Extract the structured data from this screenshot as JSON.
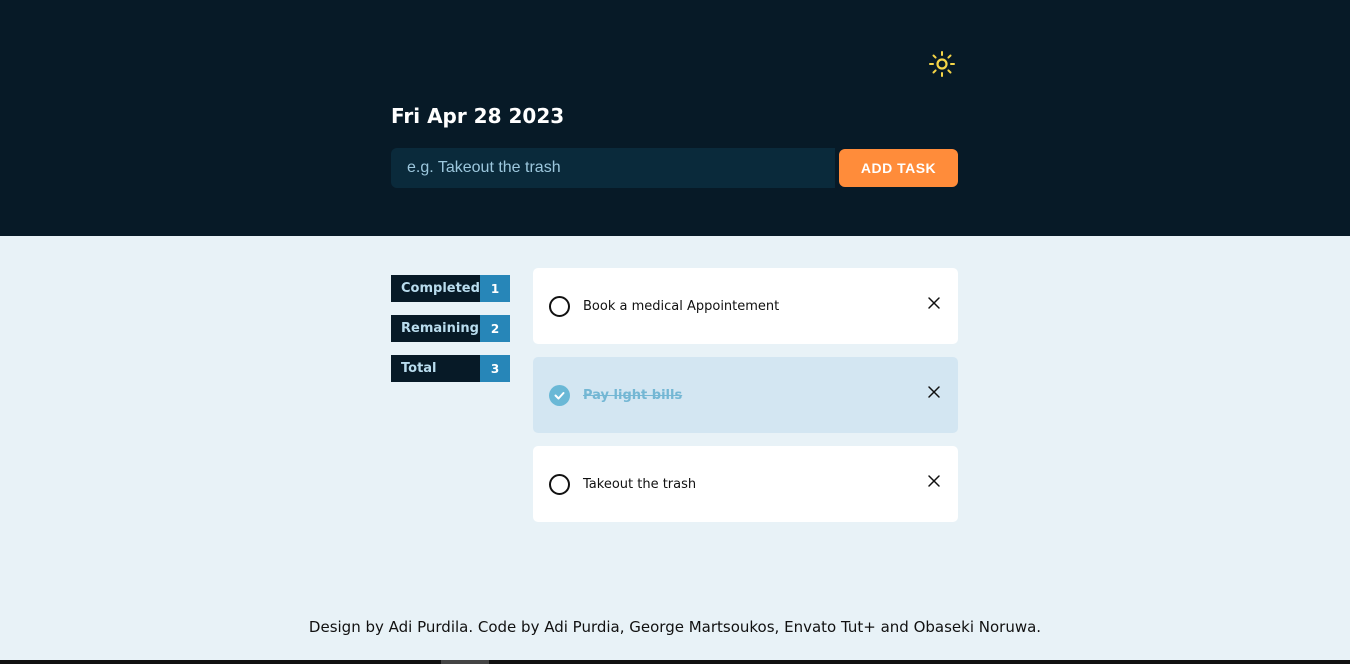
{
  "header": {
    "date": "Fri Apr 28 2023",
    "theme_icon": "sun-icon",
    "input_placeholder": "e.g. Takeout the trash",
    "add_button_label": "ADD TASK"
  },
  "stats": [
    {
      "label": "Completed",
      "count": "1"
    },
    {
      "label": "Remaining",
      "count": "2"
    },
    {
      "label": "Total",
      "count": "3"
    }
  ],
  "tasks": [
    {
      "text": "Book a medical Appointement",
      "done": false
    },
    {
      "text": "Pay light bills",
      "done": true
    },
    {
      "text": "Takeout the trash",
      "done": false
    }
  ],
  "footer": {
    "credit": "Design by Adi Purdila. Code by Adi Purdia, George Martsoukos, Envato Tut+ and Obaseki Noruwa."
  },
  "colors": {
    "header_bg": "#071a27",
    "accent": "#ff8c3a",
    "count_bg": "#2786b8",
    "done_text": "#74b7d4",
    "page_bg": "#e8f2f7"
  }
}
